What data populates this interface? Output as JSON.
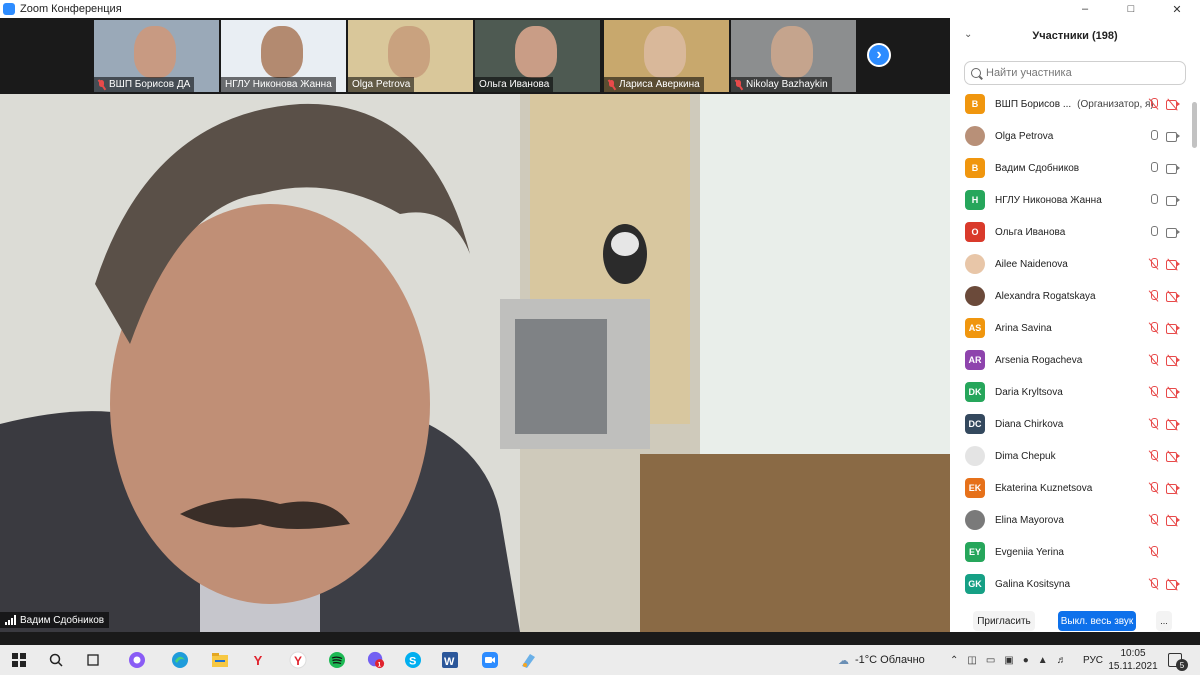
{
  "window": {
    "title": "Zoom Конференция"
  },
  "thumbnails": [
    {
      "name": "ВШП Борисов ДА",
      "muted": true,
      "bg": "#9aa9b8",
      "face": "#c89a82"
    },
    {
      "name": "НГЛУ Никонова Жанна",
      "muted": false,
      "bg": "#e9eef3",
      "face": "#b38a70"
    },
    {
      "name": "Olga Petrova",
      "muted": false,
      "bg": "#d9c79a",
      "face": "#c9a27f"
    },
    {
      "name": "Ольга Иванова",
      "muted": false,
      "bg": "#4e5a52",
      "face": "#c99d86"
    },
    {
      "name": "Лариса Аверкина",
      "muted": true,
      "bg": "#c8a86d",
      "face": "#d9b89a"
    },
    {
      "name": "Nikolay Bazhaykin",
      "muted": true,
      "bg": "#8c8e8f",
      "face": "#c5a48d"
    }
  ],
  "main_speaker": {
    "name": "Вадим Сдобников"
  },
  "participants_panel": {
    "title": "Участники (198)",
    "search_placeholder": "Найти участника",
    "participants": [
      {
        "initials": "В",
        "name": "ВШП Борисов ...",
        "role": "(Организатор, я)",
        "color": "#f0960e",
        "mic": "off",
        "cam": "off"
      },
      {
        "initials": "",
        "name": "Olga Petrova",
        "role": "",
        "color": "#b89078",
        "mic": "on",
        "cam": "on"
      },
      {
        "initials": "В",
        "name": "Вадим Сдобников",
        "role": "",
        "color": "#f0960e",
        "mic": "on",
        "cam": "on"
      },
      {
        "initials": "Н",
        "name": "НГЛУ Никонова Жанна",
        "role": "",
        "color": "#26a65b",
        "mic": "on",
        "cam": "on"
      },
      {
        "initials": "О",
        "name": "Ольга Иванова",
        "role": "",
        "color": "#d93a2b",
        "mic": "on",
        "cam": "on"
      },
      {
        "initials": "",
        "name": "Ailee Naidenova",
        "role": "",
        "color": "#e8c6a8",
        "mic": "off",
        "cam": "off"
      },
      {
        "initials": "",
        "name": "Alexandra Rogatskaya",
        "role": "",
        "color": "#6b4a3a",
        "mic": "off",
        "cam": "off"
      },
      {
        "initials": "AS",
        "name": "Arina Savina",
        "role": "",
        "color": "#f0960e",
        "mic": "off",
        "cam": "off"
      },
      {
        "initials": "AR",
        "name": "Arsenia Rogacheva",
        "role": "",
        "color": "#8e44ad",
        "mic": "off",
        "cam": "off"
      },
      {
        "initials": "DK",
        "name": "Daria Kryltsova",
        "role": "",
        "color": "#26a65b",
        "mic": "off",
        "cam": "off"
      },
      {
        "initials": "DC",
        "name": "Diana Chirkova",
        "role": "",
        "color": "#34495e",
        "mic": "off",
        "cam": "off"
      },
      {
        "initials": "",
        "name": "Dima Chepuk",
        "role": "",
        "color": "#e4e4e4",
        "mic": "off",
        "cam": "off"
      },
      {
        "initials": "EK",
        "name": "Ekaterina Kuznetsova",
        "role": "",
        "color": "#e6711a",
        "mic": "off",
        "cam": "off"
      },
      {
        "initials": "",
        "name": "Elina Mayorova",
        "role": "",
        "color": "#7a7a7a",
        "mic": "off",
        "cam": "off"
      },
      {
        "initials": "EY",
        "name": "Evgeniia Yerina",
        "role": "",
        "color": "#26a65b",
        "mic": "off",
        "cam": "none"
      },
      {
        "initials": "GK",
        "name": "Galina Kositsyna",
        "role": "",
        "color": "#16a085",
        "mic": "off",
        "cam": "off"
      }
    ],
    "invite_label": "Пригласить",
    "mute_all_label": "Выкл. весь звук",
    "more_label": "..."
  },
  "taskbar": {
    "weather": "-1°C  Облачно",
    "language": "РУС",
    "time": "10:05",
    "date": "15.11.2021",
    "notifications": "5",
    "app_icons": [
      "windows-start-icon",
      "search-icon",
      "task-view-icon",
      "alice-icon",
      "edge-icon",
      "file-explorer-icon",
      "yandex-icon",
      "yandex-browser-icon",
      "spotify-icon",
      "viber-icon",
      "skype-icon",
      "word-icon",
      "zoom-icon",
      "paint-icon"
    ]
  }
}
